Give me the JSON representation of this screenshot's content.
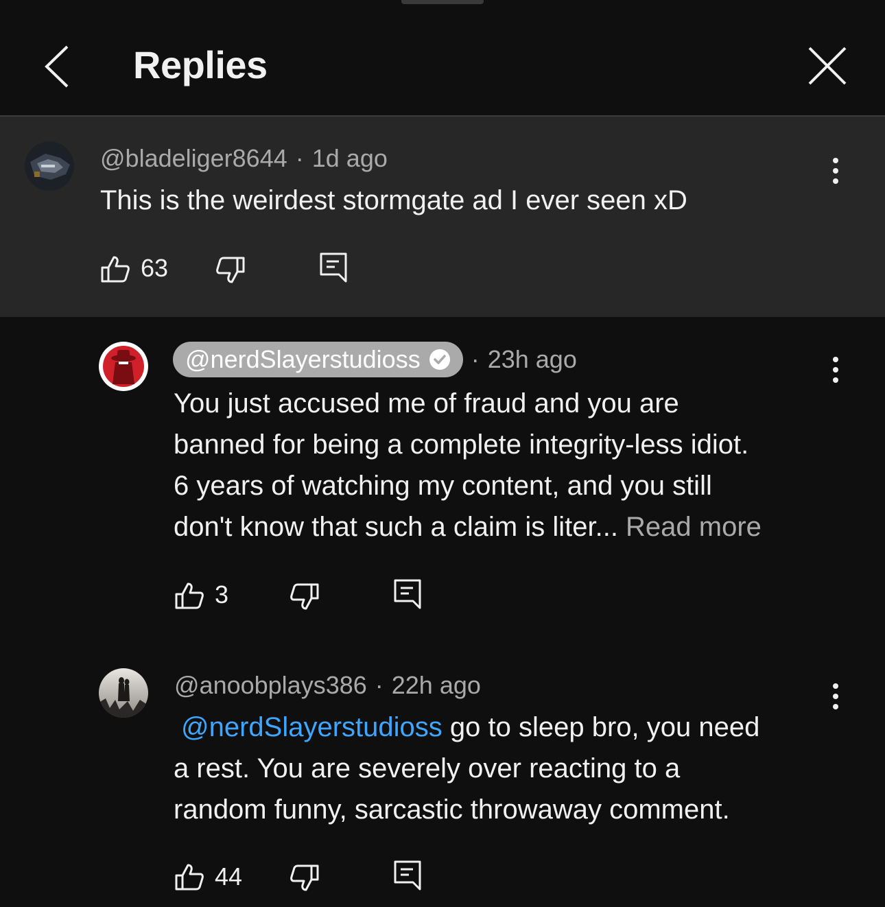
{
  "header": {
    "title": "Replies"
  },
  "parent_comment": {
    "author": "@bladeliger8644",
    "time": "1d ago",
    "text": "This is the weirdest stormgate ad I ever seen xD",
    "likes": "63"
  },
  "replies": [
    {
      "author": "@nerdSlayerstudioss",
      "time": "23h ago",
      "text_lines": [
        "You just accused me of fraud and you are",
        "banned for being a complete integrity-less idiot.",
        "6 years of watching my content, and you still",
        "don't know that such a claim is liter... "
      ],
      "read_more": "Read more",
      "likes": "3"
    },
    {
      "author": "@anoobplays386",
      "time": "22h ago",
      "mention": "@nerdSlayerstudioss",
      "text_line1_rest": " go to sleep bro, you need",
      "text_lines": [
        "a rest. You are severely over reacting to a",
        "random funny, sarcastic throwaway comment."
      ],
      "likes": "44"
    }
  ],
  "colors": {
    "background": "#0f0f0f",
    "highlight": "#272727",
    "mention": "#3ea6ff",
    "secondary_text": "#aaaaaa"
  }
}
